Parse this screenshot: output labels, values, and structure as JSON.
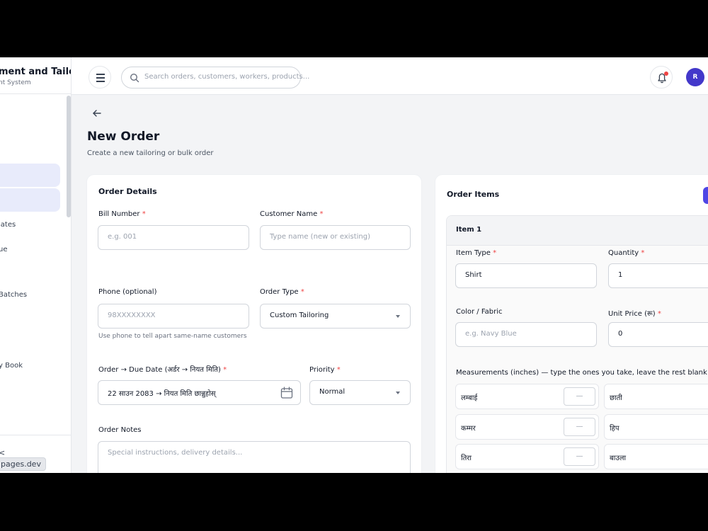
{
  "sidebar": {
    "brand_title": "ment and Tailo",
    "brand_subtitle": "nt System",
    "items": [
      {
        "label": ""
      },
      {
        "label": ""
      },
      {
        "label": "lates"
      },
      {
        "label": "ue"
      },
      {
        "label": "Batches"
      },
      {
        "label": "y Book"
      }
    ],
    "footer_mark": "<",
    "url_status": "pages.dev"
  },
  "topbar": {
    "menu_icon": "hamburger-icon",
    "search_placeholder": "Search orders, customers, workers, products...",
    "avatar_initial": "R"
  },
  "page": {
    "title": "New Order",
    "subtitle": "Create a new tailoring or bulk order"
  },
  "order_details": {
    "title": "Order Details",
    "bill_number": {
      "label": "Bill Number",
      "placeholder": "e.g. 001"
    },
    "customer_name": {
      "label": "Customer Name",
      "placeholder": "Type name (new or existing)"
    },
    "phone": {
      "label": "Phone (optional)",
      "placeholder": "98XXXXXXXX",
      "hint": "Use phone to tell apart same-name customers"
    },
    "order_type": {
      "label": "Order Type",
      "value": "Custom Tailoring"
    },
    "due_date": {
      "label": "Order → Due Date (अर्डर → नियत मिति)",
      "value": "22 साउन 2083  →  नियत मिति छान्नुहोस्"
    },
    "priority": {
      "label": "Priority",
      "value": "Normal"
    },
    "notes": {
      "label": "Order Notes",
      "placeholder": "Special instructions, delivery details..."
    }
  },
  "order_items": {
    "title": "Order Items",
    "item": {
      "title": "Item 1",
      "item_type": {
        "label": "Item Type",
        "value": "Shirt"
      },
      "quantity": {
        "label": "Quantity",
        "value": "1"
      },
      "color": {
        "label": "Color / Fabric",
        "placeholder": "e.g. Navy Blue"
      },
      "unit_price": {
        "label": "Unit Price (रू)",
        "value": "0"
      },
      "measurements_label": "Measurements (inches) — type the ones you take, leave the rest blank",
      "measurements": [
        {
          "name": "लम्बाई",
          "value": "—"
        },
        {
          "name": "छाती",
          "value": ""
        },
        {
          "name": "कम्मर",
          "value": "—"
        },
        {
          "name": "हिप",
          "value": ""
        },
        {
          "name": "तिरा",
          "value": "—"
        },
        {
          "name": "बाउला",
          "value": ""
        }
      ]
    }
  },
  "required_mark": "*",
  "colors": {
    "accent": "#4f46e5",
    "required": "#ef4444",
    "highlight": "#e8ebfb"
  }
}
